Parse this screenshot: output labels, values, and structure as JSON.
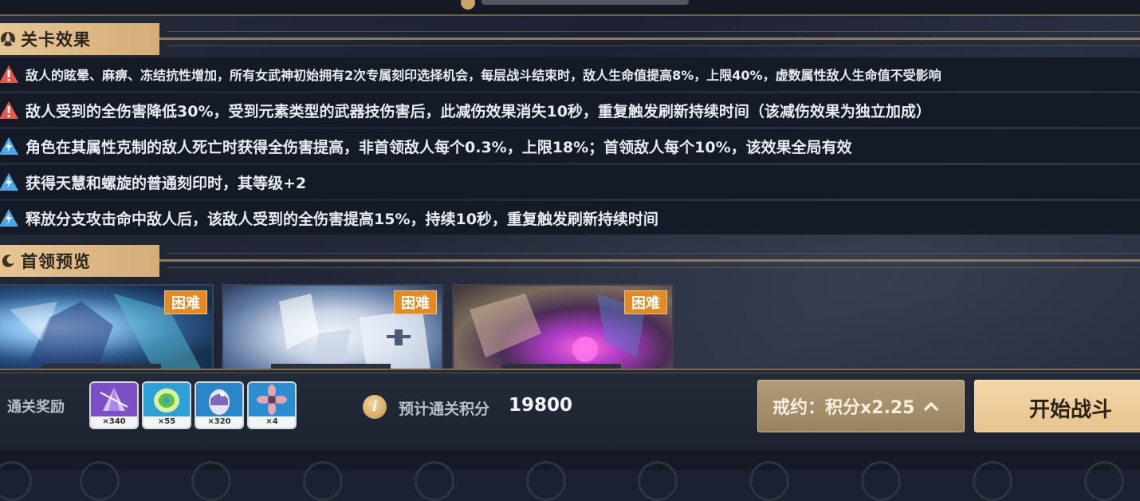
{
  "sections": {
    "effects_title": "关卡效果",
    "bosses_title": "首领预览"
  },
  "effects": [
    {
      "type": "warning",
      "text": "敌人的眩晕、麻痹、冻结抗性增加，所有女武神初始拥有2次专属刻印选择机会，每层战斗结束时，敌人生命值提高8%，上限40%，虚数属性敌人生命值不受影响"
    },
    {
      "type": "warning",
      "text": "敌人受到的全伤害降低30%，受到元素类型的武器技伤害后，此减伤效果消失10秒，重复触发刷新持续时间（该减伤效果为独立加成）"
    },
    {
      "type": "buff",
      "text": "角色在其属性克制的敌人死亡时获得全伤害提高，非首领敌人每个0.3%，上限18%；首领敌人每个10%，该效果全局有效"
    },
    {
      "type": "buff",
      "text": "获得天慧和螺旋的普通刻印时，其等级+2"
    },
    {
      "type": "buff",
      "text": "释放分支攻击命中敌人后，该敌人受到的全伤害提高15%，持续10秒，重复触发刷新持续时间"
    }
  ],
  "bosses": [
    {
      "difficulty": "困难"
    },
    {
      "difficulty": "困难"
    },
    {
      "difficulty": "困难"
    }
  ],
  "rewards": {
    "label": "通关奖励",
    "items": [
      {
        "count": "×340"
      },
      {
        "count": "×55"
      },
      {
        "count": "×320"
      },
      {
        "count": "×4"
      }
    ]
  },
  "score": {
    "icon_text": "i",
    "label": "预计通关积分",
    "value": "19800"
  },
  "buttons": {
    "pact": "戒约：积分x2.25",
    "start": "开始战斗"
  },
  "colors": {
    "tab_gold": "#e7c593",
    "warning_red": "#e4574d",
    "buff_blue": "#4da6e8",
    "difficulty_orange": "#e38a25"
  }
}
